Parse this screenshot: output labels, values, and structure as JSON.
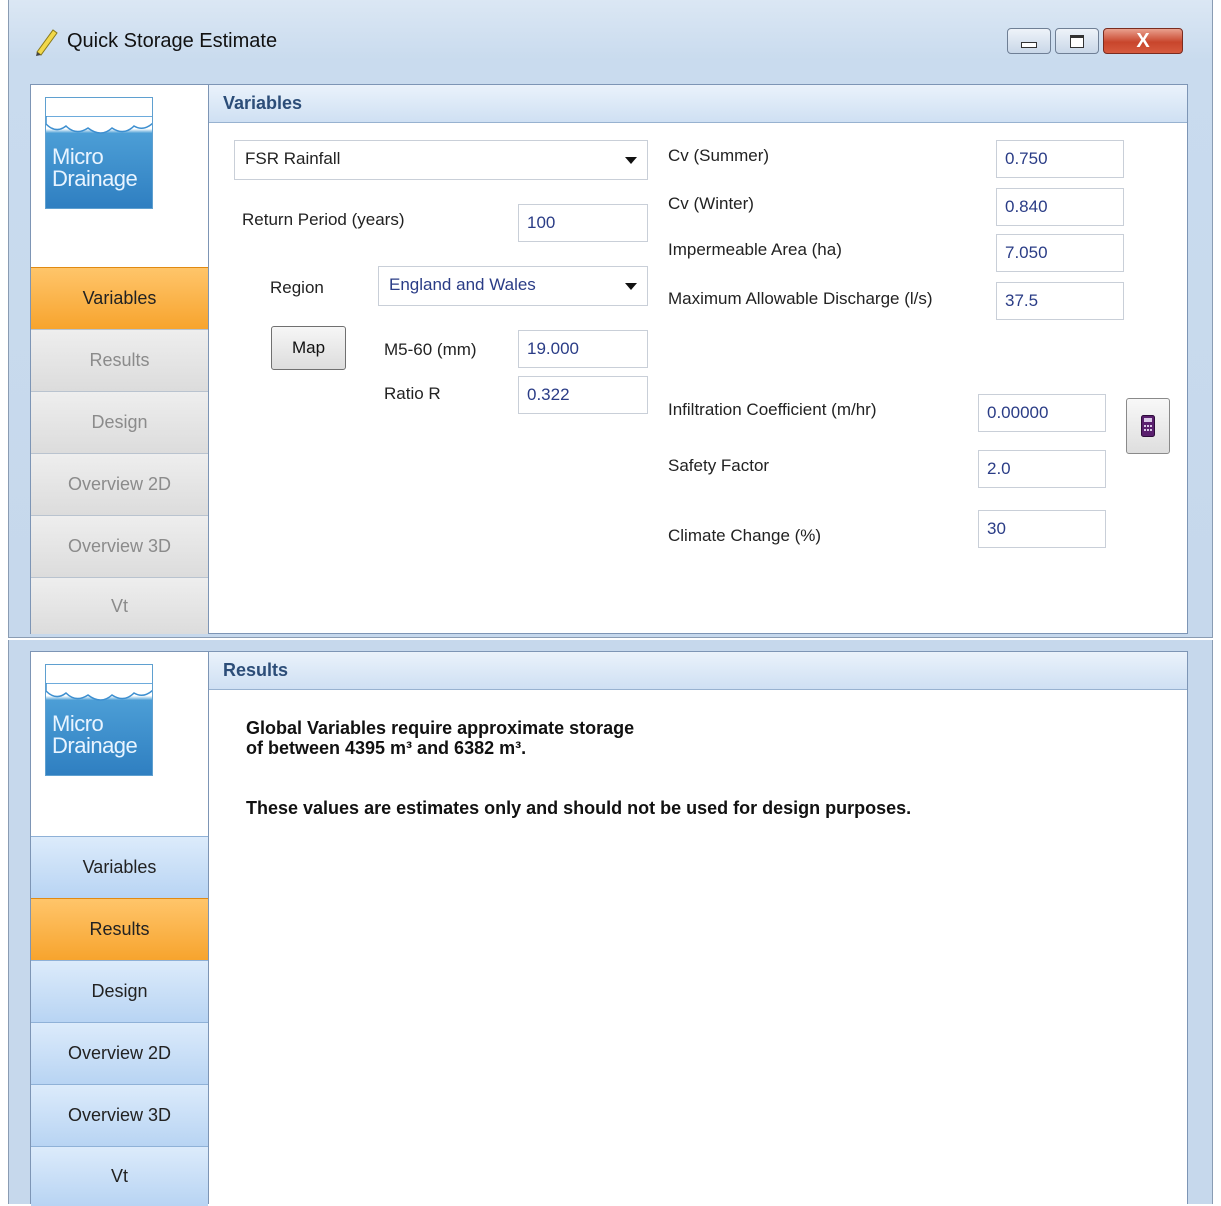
{
  "window": {
    "title": "Quick Storage Estimate",
    "close_symbol": "X"
  },
  "logo": {
    "line1": "Micro",
    "line2": "Drainage"
  },
  "nav_top": [
    {
      "label": "Variables",
      "state": "active"
    },
    {
      "label": "Results",
      "state": "disabled"
    },
    {
      "label": "Design",
      "state": "disabled"
    },
    {
      "label": "Overview 2D",
      "state": "disabled"
    },
    {
      "label": "Overview 3D",
      "state": "disabled"
    },
    {
      "label": "Vt",
      "state": "disabled"
    }
  ],
  "nav_bottom": [
    {
      "label": "Variables",
      "state": "normal"
    },
    {
      "label": "Results",
      "state": "active"
    },
    {
      "label": "Design",
      "state": "normal"
    },
    {
      "label": "Overview 2D",
      "state": "normal"
    },
    {
      "label": "Overview 3D",
      "state": "normal"
    },
    {
      "label": "Vt",
      "state": "normal"
    }
  ],
  "variables": {
    "header": "Variables",
    "rainfall_model": "FSR Rainfall",
    "return_period_label": "Return Period (years)",
    "return_period": "100",
    "region_label": "Region",
    "region": "England and Wales",
    "map_button": "Map",
    "m560_label": "M5-60 (mm)",
    "m560": "19.000",
    "ratio_r_label": "Ratio R",
    "ratio_r": "0.322",
    "cv_summer_label": "Cv (Summer)",
    "cv_summer": "0.750",
    "cv_winter_label": "Cv (Winter)",
    "cv_winter": "0.840",
    "impermeable_label": "Impermeable Area (ha)",
    "impermeable": "7.050",
    "max_discharge_label": "Maximum Allowable Discharge (l/s)",
    "max_discharge": "37.5",
    "infiltration_label": "Infiltration Coefficient (m/hr)",
    "infiltration": "0.00000",
    "safety_label": "Safety Factor",
    "safety": "2.0",
    "climate_label": "Climate Change (%)",
    "climate": "30"
  },
  "results": {
    "header": "Results",
    "line1": "Global Variables require approximate storage",
    "line2": "of between 4395 m³ and 6382 m³.",
    "line3": "These values are estimates only and should not be used for design purposes."
  },
  "colors": {
    "active_tab": "#f7a42e",
    "header_text": "#2c4d78",
    "value_text": "#2a3c86"
  }
}
